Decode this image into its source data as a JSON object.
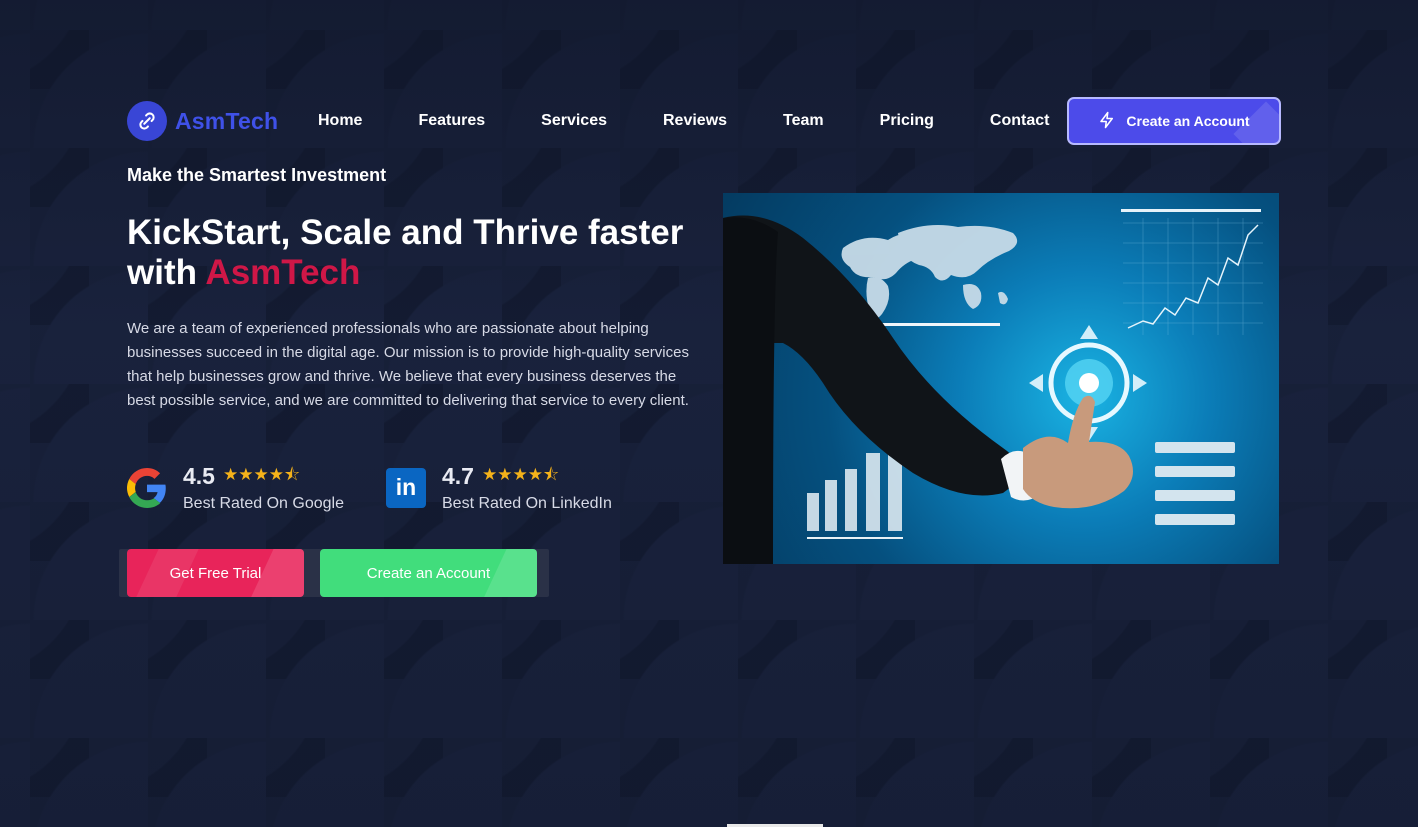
{
  "brand": {
    "name": "AsmTech",
    "logo_icon": "link-icon",
    "color": "#3f51e8"
  },
  "nav": {
    "items": [
      "Home",
      "Features",
      "Services",
      "Reviews",
      "Team",
      "Pricing",
      "Contact"
    ]
  },
  "header_cta": {
    "label": "Create an Account",
    "icon": "lightning-icon",
    "color": "#4c4bea"
  },
  "hero": {
    "eyebrow": "Make the Smartest Investment",
    "headline_part1": "KickStart, Scale and Thrive faster with ",
    "headline_brand": "AsmTech",
    "description": "We are a team of experienced professionals who are passionate about helping businesses succeed in the digital age. Our mission is to provide high-quality services that help businesses grow and thrive. We believe that every business deserves the best possible service, and we are committed to delivering that service to every client.",
    "accent_color": "#cf1747"
  },
  "ratings": [
    {
      "score": "4.5",
      "stars": "★★★★⯪",
      "stars_value": 4.5,
      "label": "Best Rated On Google",
      "icon": "google-icon"
    },
    {
      "score": "4.7",
      "stars": "★★★★⯪",
      "stars_value": 4.7,
      "label": "Best Rated On LinkedIn",
      "icon": "linkedin-icon",
      "icon_text": "in"
    }
  ],
  "buttons": {
    "trial": {
      "label": "Get Free Trial",
      "color": "#e8245a"
    },
    "account": {
      "label": "Create an Account",
      "color": "#41dd7c"
    }
  },
  "image": {
    "icon": "business-touchscreen-image"
  }
}
